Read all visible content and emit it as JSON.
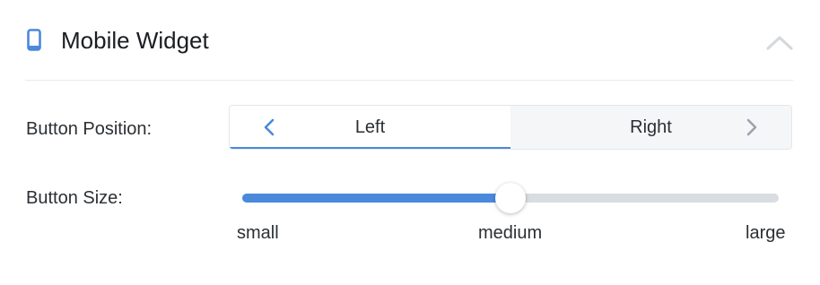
{
  "header": {
    "title": "Mobile Widget",
    "icon": "mobile-phone-icon",
    "collapse_icon": "chevron-up-icon",
    "accent_color": "#4a89dc"
  },
  "button_position": {
    "label": "Button Position:",
    "options": [
      "Left",
      "Right"
    ],
    "selected": "Left",
    "prev_icon": "chevron-left-icon",
    "next_icon": "chevron-right-icon"
  },
  "button_size": {
    "label": "Button Size:",
    "ticks": [
      "small",
      "medium",
      "large"
    ],
    "value_fraction": 0.5,
    "track_color": "#d9dce1",
    "fill_color": "#4a89dc"
  }
}
